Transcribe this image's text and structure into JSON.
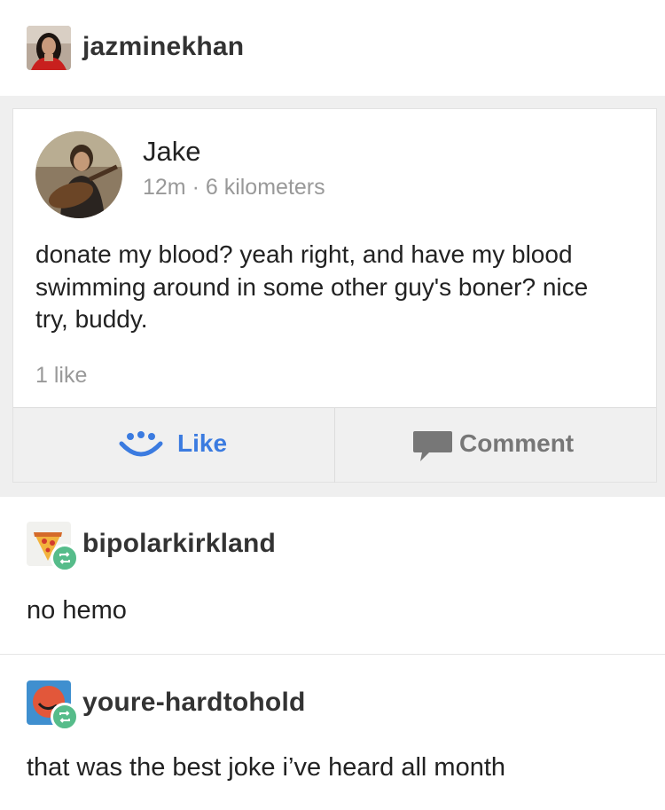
{
  "original_post": {
    "username": "jazminekhan"
  },
  "facebook_post": {
    "author": "Jake",
    "meta": "12m · 6 kilometers",
    "text": "donate my blood? yeah right, and have my blood swimming around in some other guy's boner? nice try, buddy.",
    "likes": "1 like",
    "like_label": "Like",
    "comment_label": "Comment",
    "accent_color": "#3b7be0"
  },
  "reblogs": [
    {
      "username": "bipolarkirkland",
      "text": "no hemo",
      "avatar_icon": "pizza-slice-icon"
    },
    {
      "username": "youre-hardtohold",
      "text": "that was the best joke i’ve heard all month",
      "avatar_icon": "red-circle-icon"
    }
  ],
  "reblog_badge_color": "#56bc8a"
}
